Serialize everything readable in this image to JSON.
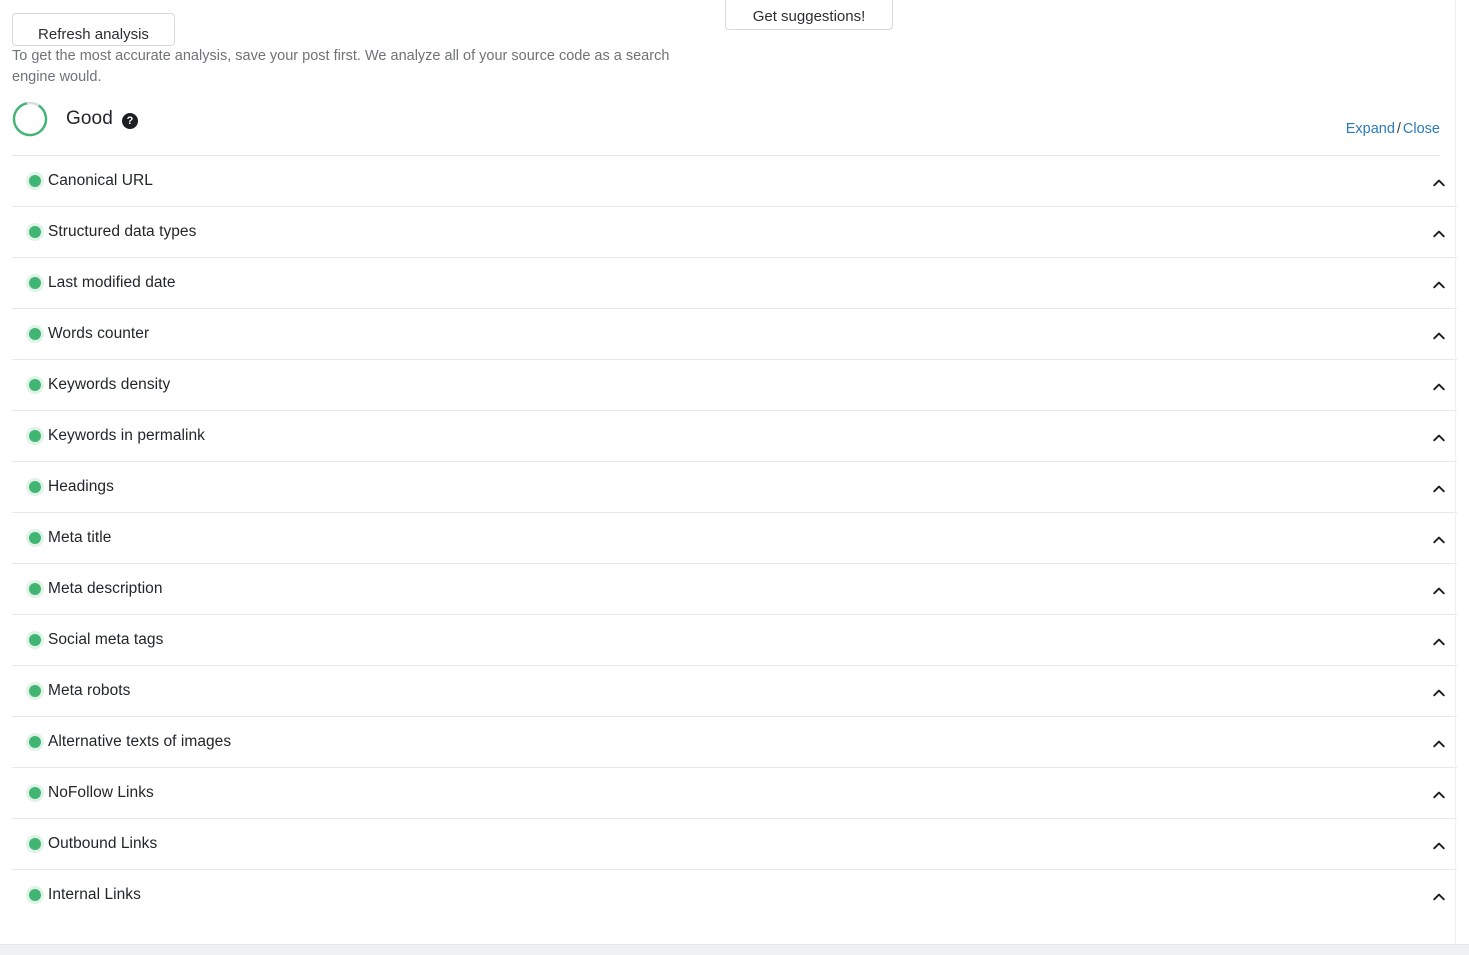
{
  "toolbar": {
    "refresh_label": "Refresh analysis",
    "suggestions_label": "Get suggestions!",
    "helper_text": "To get the most accurate analysis, save your post first. We analyze all of your source code as a search engine would."
  },
  "score": {
    "label": "Good",
    "help_icon_glyph": "?",
    "ring_percent": 87,
    "ring_color": "#41b572",
    "ring_track_color": "#d9dcdf"
  },
  "header_actions": {
    "expand_label": "Expand",
    "separator": "/",
    "close_label": "Close"
  },
  "colors": {
    "status_good": "#41b572",
    "link": "#2b7bb9",
    "text": "#22262a",
    "muted_text": "#6e7378",
    "divider": "#e6e8ea"
  },
  "checklist": {
    "rows": [
      {
        "label": "Canonical URL",
        "status": "good",
        "toggle": "chevron-up"
      },
      {
        "label": "Structured data types",
        "status": "good",
        "toggle": "chevron-up"
      },
      {
        "label": "Last modified date",
        "status": "good",
        "toggle": "chevron-up"
      },
      {
        "label": "Words counter",
        "status": "good",
        "toggle": "chevron-up"
      },
      {
        "label": "Keywords density",
        "status": "good",
        "toggle": "chevron-up"
      },
      {
        "label": "Keywords in permalink",
        "status": "good",
        "toggle": "chevron-up"
      },
      {
        "label": "Headings",
        "status": "good",
        "toggle": "chevron-up"
      },
      {
        "label": "Meta title",
        "status": "good",
        "toggle": "chevron-up"
      },
      {
        "label": "Meta description",
        "status": "good",
        "toggle": "chevron-up"
      },
      {
        "label": "Social meta tags",
        "status": "good",
        "toggle": "chevron-up"
      },
      {
        "label": "Meta robots",
        "status": "good",
        "toggle": "chevron-up"
      },
      {
        "label": "Alternative texts of images",
        "status": "good",
        "toggle": "chevron-up"
      },
      {
        "label": "NoFollow Links",
        "status": "good",
        "toggle": "chevron-up"
      },
      {
        "label": "Outbound Links",
        "status": "good",
        "toggle": "chevron-up"
      },
      {
        "label": "Internal Links",
        "status": "good",
        "toggle": "chevron-up"
      }
    ]
  }
}
